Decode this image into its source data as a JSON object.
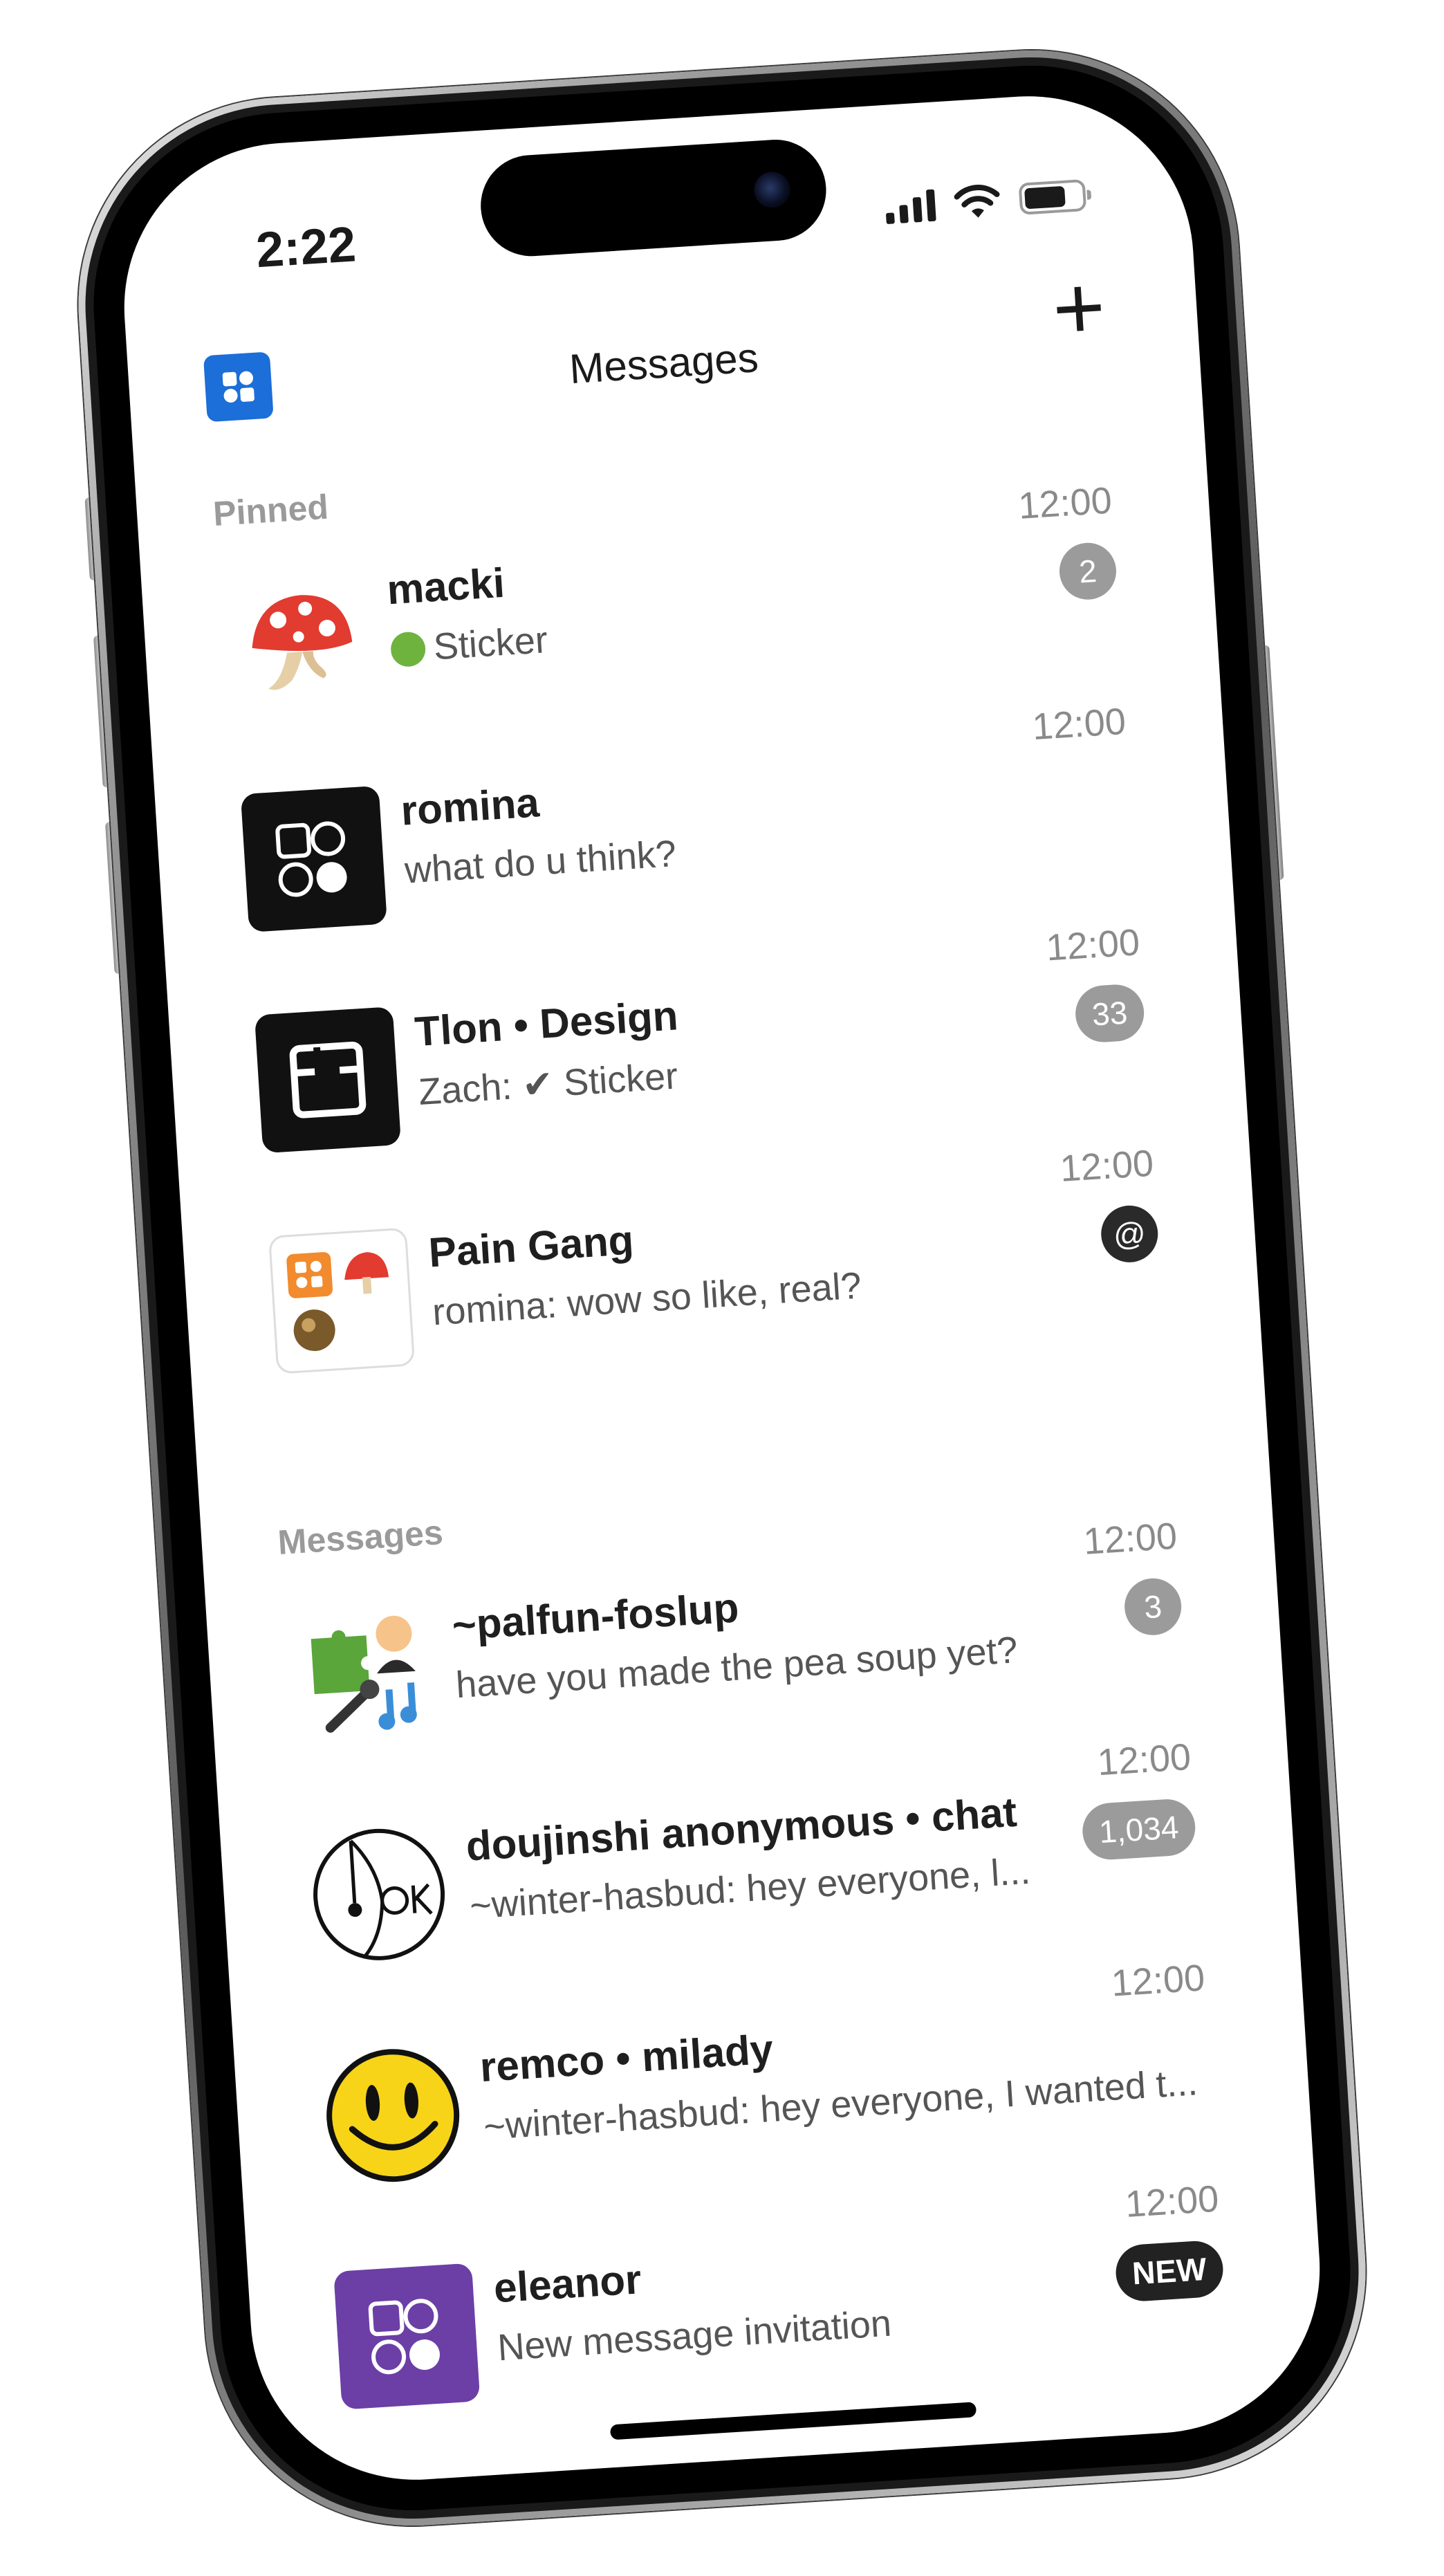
{
  "status_bar": {
    "time": "2:22",
    "icons": [
      "cellular-signal-icon",
      "wifi-icon",
      "battery-icon"
    ]
  },
  "header": {
    "title": "Messages",
    "logo_icon": "tlon-logo-icon",
    "new_label": "+"
  },
  "sections": {
    "pinned_label": "Pinned",
    "messages_label": "Messages"
  },
  "pinned": [
    {
      "name": "macki",
      "preview_icon": "nauseated-face-emoji",
      "preview": "Sticker",
      "time": "12:00",
      "badge": "2",
      "avatar": "mushroom-icon"
    },
    {
      "name": "romina",
      "preview": "what do u think?",
      "time": "12:00",
      "badge": "",
      "avatar": "tlon-glyph-icon"
    },
    {
      "name": "Tlon • Design",
      "preview": "Zach: ✔ Sticker",
      "time": "12:00",
      "badge": "33",
      "avatar": "tlon-group-icon"
    },
    {
      "name": "Pain Gang",
      "preview": "romina: wow so like, real?",
      "time": "12:00",
      "badge": "@",
      "avatar": "group-collage-icon"
    }
  ],
  "messages": [
    {
      "name": "~palfun-foslup",
      "preview": "have you made the pea soup yet?",
      "time": "12:00",
      "badge": "3",
      "avatar": "emoji-sigil-icon"
    },
    {
      "name": "doujinshi anonymous • chat",
      "preview": "~winter-hasbud: hey everyone, l...",
      "time": "12:00",
      "badge": "1,034",
      "avatar": "ok-doodle-icon"
    },
    {
      "name": "remco • milady",
      "preview": "~winter-hasbud: hey everyone, I wanted t...",
      "time": "12:00",
      "badge": "",
      "avatar": "smiley-face-icon"
    },
    {
      "name": "eleanor",
      "preview": "New message invitation",
      "time": "12:00",
      "badge": "NEW",
      "avatar": "tlon-glyph-purple-icon"
    }
  ],
  "colors": {
    "accent_blue": "#1c6ed8",
    "badge_gray": "#9b9b9b",
    "badge_dark": "#2a2a2a",
    "invite_purple": "#6b3fa6",
    "smiley_yellow": "#f7d417"
  }
}
